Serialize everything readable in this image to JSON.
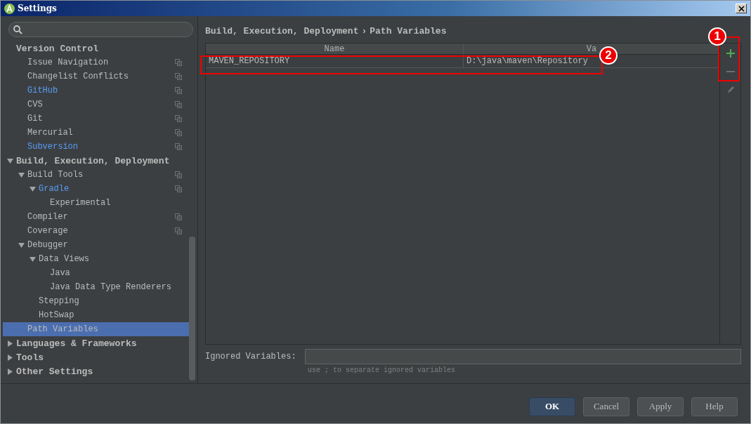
{
  "window": {
    "title": "Settings"
  },
  "sidebar": {
    "tree": [
      {
        "label": "Version Control",
        "bold": true,
        "children": [
          {
            "label": "Issue Navigation",
            "project_icon": true,
            "modified": false,
            "selected": false
          },
          {
            "label": "Changelist Conflicts",
            "project_icon": true,
            "modified": false,
            "selected": false
          },
          {
            "label": "GitHub",
            "project_icon": true,
            "modified": true,
            "selected": false
          },
          {
            "label": "CVS",
            "project_icon": true,
            "modified": false,
            "selected": false
          },
          {
            "label": "Git",
            "project_icon": true,
            "modified": false,
            "selected": false
          },
          {
            "label": "Mercurial",
            "project_icon": true,
            "modified": false,
            "selected": false
          },
          {
            "label": "Subversion",
            "project_icon": true,
            "modified": true,
            "selected": false
          }
        ]
      },
      {
        "label": "Build, Execution, Deployment",
        "bold": true,
        "expanded": true,
        "children": [
          {
            "label": "Build Tools",
            "project_icon": true,
            "modified": false,
            "expanded": true,
            "selected": false,
            "children": [
              {
                "label": "Gradle",
                "project_icon": true,
                "modified": true,
                "expanded": true,
                "selected": false,
                "children": [
                  {
                    "label": "Experimental",
                    "modified": false,
                    "selected": false
                  }
                ]
              }
            ]
          },
          {
            "label": "Compiler",
            "project_icon": true,
            "modified": false,
            "selected": false
          },
          {
            "label": "Coverage",
            "project_icon": true,
            "modified": false,
            "selected": false
          },
          {
            "label": "Debugger",
            "modified": false,
            "expanded": true,
            "selected": false,
            "children": [
              {
                "label": "Data Views",
                "modified": false,
                "expanded": true,
                "selected": false,
                "children": [
                  {
                    "label": "Java",
                    "modified": false,
                    "selected": false
                  },
                  {
                    "label": "Java Data Type Renderers",
                    "modified": false,
                    "selected": false
                  }
                ]
              },
              {
                "label": "Stepping",
                "modified": false,
                "selected": false
              },
              {
                "label": "HotSwap",
                "modified": false,
                "selected": false
              }
            ]
          },
          {
            "label": "Path Variables",
            "modified": false,
            "selected": true
          }
        ]
      },
      {
        "label": "Languages & Frameworks",
        "bold": true,
        "expanded": false
      },
      {
        "label": "Tools",
        "bold": true,
        "expanded": false
      },
      {
        "label": "Other Settings",
        "bold": true,
        "expanded": false
      }
    ]
  },
  "breadcrumb": {
    "separator": "›",
    "items": [
      "Build, Execution, Deployment",
      "Path Variables"
    ]
  },
  "table": {
    "columns": [
      "Name",
      "Va"
    ],
    "rows": [
      {
        "cells": [
          "MAVEN_REPOSITORY",
          "D:\\java\\maven\\Repository"
        ]
      }
    ]
  },
  "annotations": [
    {
      "number": "1"
    },
    {
      "number": "2"
    }
  ],
  "ignored": {
    "label": "Ignored Variables:",
    "hint": "use ; to separate ignored variables"
  },
  "buttons": [
    {
      "label": "OK",
      "default": true
    },
    {
      "label": "Cancel",
      "default": false
    },
    {
      "label": "Apply",
      "default": false
    },
    {
      "label": "Help",
      "default": false
    }
  ]
}
